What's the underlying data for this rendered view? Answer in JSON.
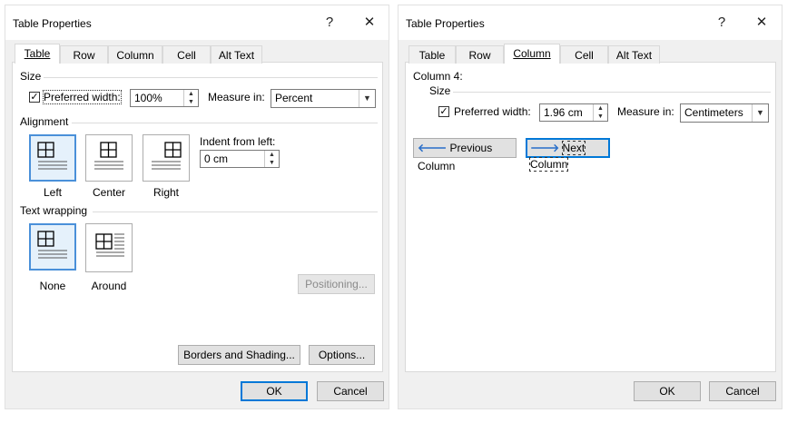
{
  "left_dialog": {
    "title": "Table Properties",
    "help": "?",
    "close": "✕",
    "tabs": [
      "Table",
      "Row",
      "Column",
      "Cell",
      "Alt Text"
    ],
    "size": {
      "label": "Size",
      "preferred_width_label": "Preferred width:",
      "preferred_width_checked": true,
      "width_value": "100%",
      "measure_label": "Measure in:",
      "measure_value": "Percent"
    },
    "alignment": {
      "label": "Alignment",
      "options": [
        "Left",
        "Center",
        "Right"
      ],
      "selected": "Left",
      "indent_label": "Indent from left:",
      "indent_value": "0 cm"
    },
    "text_wrapping": {
      "label": "Text wrapping",
      "options": [
        "None",
        "Around"
      ],
      "selected": "None",
      "positioning_button": "Positioning..."
    },
    "borders_button": "Borders and Shading...",
    "options_button": "Options...",
    "ok": "OK",
    "cancel": "Cancel"
  },
  "right_dialog": {
    "title": "Table Properties",
    "help": "?",
    "close": "✕",
    "tabs": [
      "Table",
      "Row",
      "Column",
      "Cell",
      "Alt Text"
    ],
    "column_label": "Column 4:",
    "size": {
      "label": "Size",
      "preferred_width_label": "Preferred width:",
      "preferred_width_checked": true,
      "width_value": "1.96 cm",
      "measure_label": "Measure in:",
      "measure_value": "Centimeters"
    },
    "previous_column": "Previous Column",
    "next_column": "Next Column",
    "ok": "OK",
    "cancel": "Cancel"
  },
  "colors": {
    "accent": "#0078d7",
    "selection_border": "#4a90d9",
    "selection_fill": "#e5f1fb"
  }
}
